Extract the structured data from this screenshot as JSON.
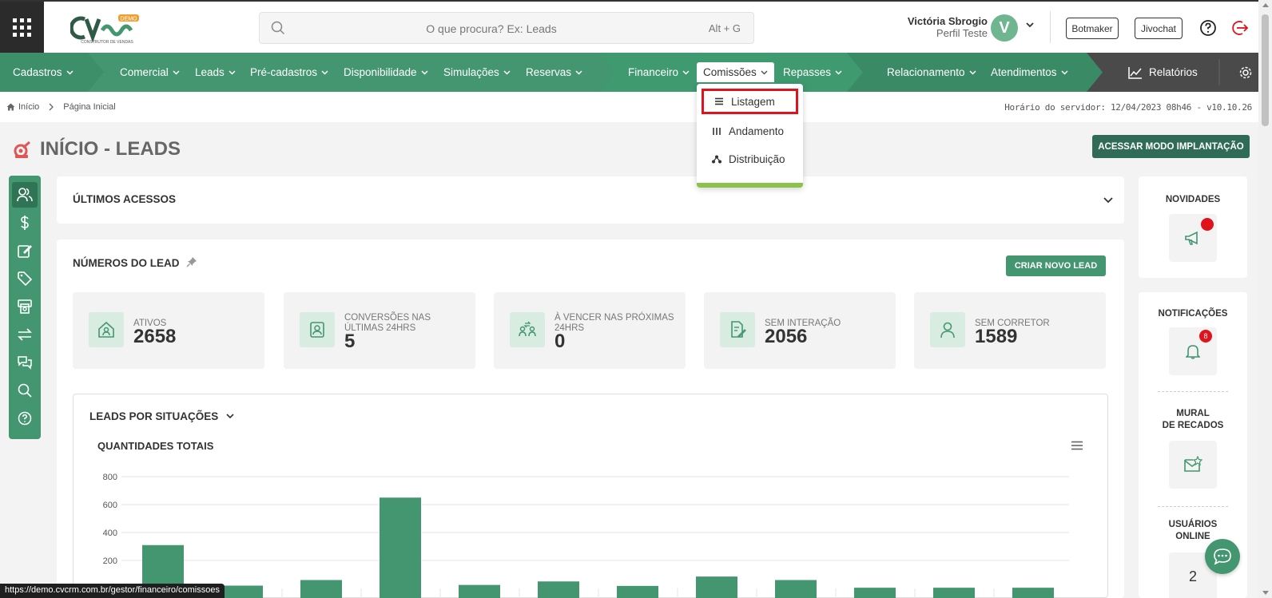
{
  "header": {
    "logo_badge": "DEMO",
    "logo_subtitle": "CONSTRUTOR DE VENDAS",
    "search_placeholder": "O que procura? Ex: Leads",
    "search_shortcut": "Alt + G",
    "user_name": "Victória Sbrogio",
    "user_profile": "Perfil Teste",
    "avatar_initial": "V",
    "botmaker_label": "Botmaker",
    "jivochat_label": "Jivochat"
  },
  "nav": {
    "items": [
      "Cadastros",
      "Comercial",
      "Leads",
      "Pré-cadastros",
      "Disponibilidade",
      "Simulações",
      "Reservas",
      "Financeiro",
      "Comissões",
      "Repasses",
      "Relacionamento",
      "Atendimentos",
      "Relatórios"
    ],
    "active": "Comissões"
  },
  "dropdown": {
    "items": [
      "Listagem",
      "Andamento",
      "Distribuição"
    ],
    "highlighted": "Listagem"
  },
  "breadcrumb": {
    "home": "Início",
    "current": "Página Inicial"
  },
  "server_time": "Horário do servidor: 12/04/2023 08h46 - v10.10.26",
  "page_title": "INÍCIO - LEADS",
  "implant_button": "ACESSAR MODO IMPLANTAÇÃO",
  "recent_access": {
    "title": "ÚLTIMOS ACESSOS"
  },
  "lead_numbers": {
    "title": "NÚMEROS DO LEAD",
    "new_lead_button": "CRIAR NOVO LEAD",
    "stats": [
      {
        "label": "ATIVOS",
        "value": "2658",
        "icon": "house-user-icon"
      },
      {
        "label": "CONVERSÕES NAS ÚLTIMAS 24hrs",
        "value": "5",
        "icon": "id-badge-icon"
      },
      {
        "label": "À VENCER NAS PRÓXIMAS 24hrs",
        "value": "0",
        "icon": "users-exchange-icon"
      },
      {
        "label": "SEM INTERAÇÃO",
        "value": "2056",
        "icon": "file-edit-icon"
      },
      {
        "label": "SEM CORRETOR",
        "value": "1589",
        "icon": "user-icon"
      }
    ]
  },
  "chart_section": {
    "title": "LEADS POR SITUAÇÕES",
    "subtitle": "QUANTIDADES TOTAIS"
  },
  "chart_data": {
    "type": "bar",
    "title": "QUANTIDADES TOTAIS",
    "xlabel": "",
    "ylabel": "",
    "ylim": [
      0,
      800
    ],
    "yticks": [
      "200",
      "400",
      "600",
      "800"
    ],
    "values": [
      310,
      20,
      60,
      650,
      25,
      50,
      18,
      85,
      60,
      5,
      5,
      5
    ],
    "color": "#43966f",
    "grid": true
  },
  "right_panel": {
    "news_title": "NOVIDADES",
    "notifications_title": "NOTIFICAÇÕES",
    "notifications_count": "8",
    "mural_title_line1": "MURAL",
    "mural_title_line2": "DE RECADOS",
    "online_title_line1": "USUÁRIOS",
    "online_title_line2": "ONLINE",
    "online_count": "2"
  },
  "status_url": "https://demo.cvcrm.com.br/gestor/financeiro/comissoes",
  "colors": {
    "brand_green": "#43966f",
    "dark_green": "#2f6b57",
    "highlight_red": "#e0121b",
    "accent_lime": "#8bc34a"
  }
}
